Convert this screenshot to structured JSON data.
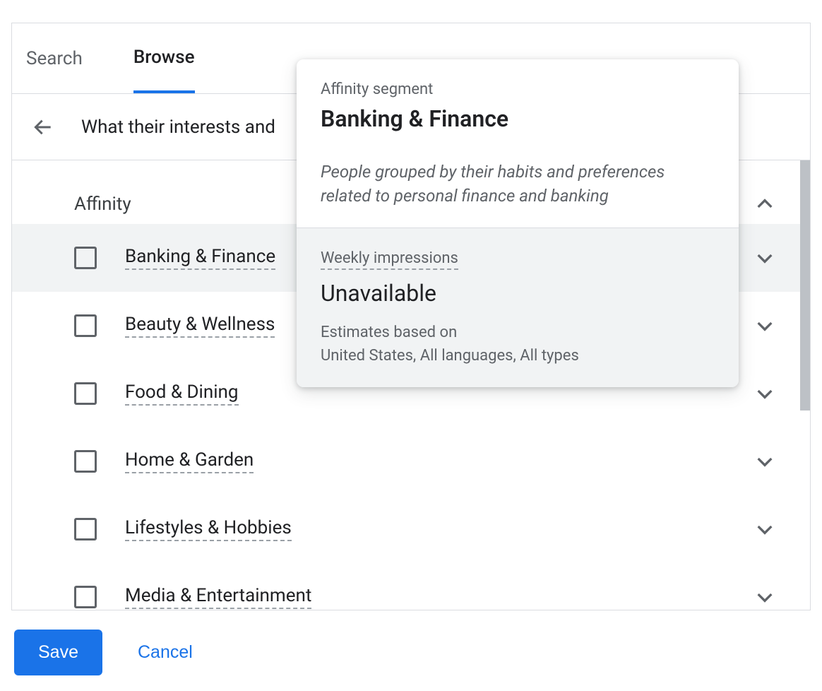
{
  "tabs": {
    "search": "Search",
    "browse": "Browse"
  },
  "breadcrumb": "What their interests and",
  "section_title": "Affinity",
  "rows": [
    {
      "label": "Banking & Finance",
      "hovered": true
    },
    {
      "label": "Beauty & Wellness",
      "hovered": false
    },
    {
      "label": "Food & Dining",
      "hovered": false
    },
    {
      "label": "Home & Garden",
      "hovered": false
    },
    {
      "label": "Lifestyles & Hobbies",
      "hovered": false
    },
    {
      "label": "Media & Entertainment",
      "hovered": false
    }
  ],
  "popover": {
    "eyebrow": "Affinity segment",
    "title": "Banking & Finance",
    "description": "People grouped by their habits and preferences related to personal finance and banking",
    "impressions_label": "Weekly impressions",
    "impressions_value": "Unavailable",
    "estimates_label": "Estimates based on",
    "estimates_value": "United States, All languages, All types"
  },
  "footer": {
    "save": "Save",
    "cancel": "Cancel"
  }
}
